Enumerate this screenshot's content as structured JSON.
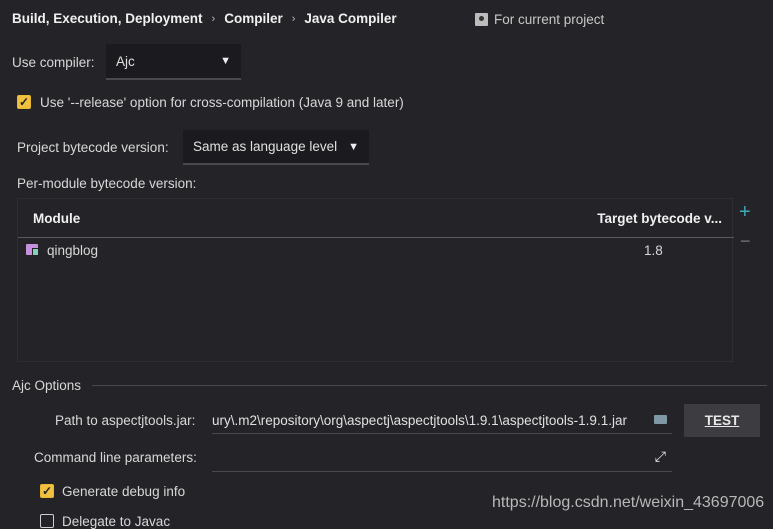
{
  "breadcrumb": [
    "Build, Execution, Deployment",
    "Compiler",
    "Java Compiler"
  ],
  "scope": {
    "icon": "project-person-icon",
    "label": "For current project"
  },
  "compiler": {
    "label": "Use compiler:",
    "value": "Ajc"
  },
  "release_option": {
    "label": "Use '--release' option for cross-compilation (Java 9 and later)",
    "checked": true
  },
  "bytecode": {
    "label": "Project bytecode version:",
    "value": "Same as language level"
  },
  "per_module": {
    "label": "Per-module bytecode version:",
    "columns": [
      "Module",
      "Target bytecode v..."
    ],
    "rows": [
      {
        "module": "qingblog",
        "target": "1.8",
        "icon": "module-folder-icon"
      }
    ],
    "add": "+",
    "remove": "−"
  },
  "ajc": {
    "section": "Ajc Options",
    "path_label": "Path to aspectjtools.jar:",
    "path_value": "ury\\.m2\\repository\\org\\aspectj\\aspectjtools\\1.9.1\\aspectjtools-1.9.1.jar",
    "test_label": "TEST",
    "cmd_label": "Command line parameters:",
    "cmd_value": "",
    "debug_label": "Generate debug info",
    "debug_checked": true,
    "delegate_label": "Delegate to Javac",
    "delegate_checked": false
  },
  "watermark": "https://blog.csdn.net/weixin_43697006",
  "colors": {
    "accent_checkbox": "#f0c040",
    "add_icon": "#3fa9b5",
    "module_icon": "#c88fe0"
  }
}
